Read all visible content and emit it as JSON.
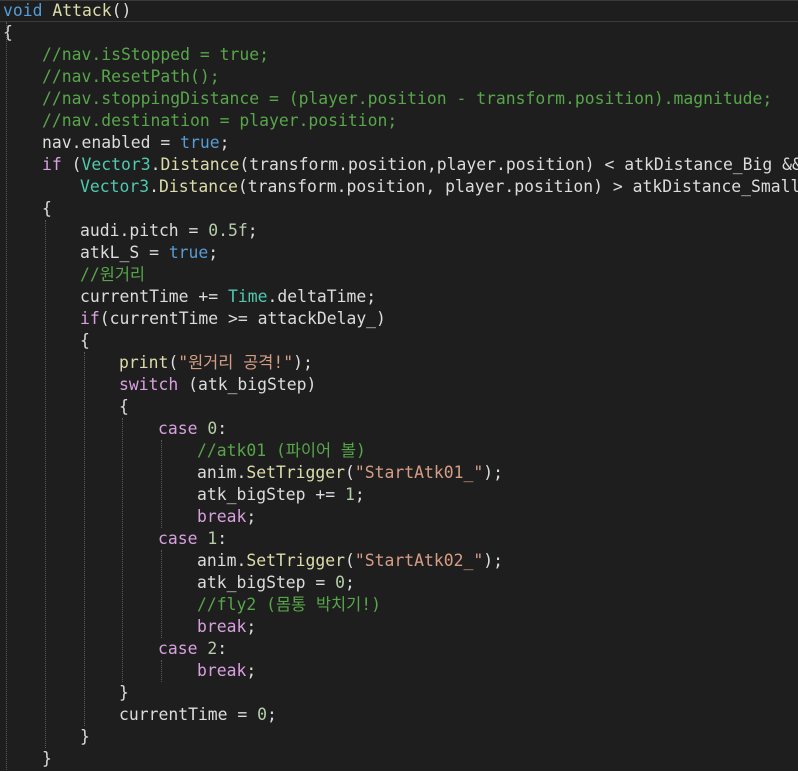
{
  "editor": {
    "language": "C#",
    "theme_background": "#1e1e1e",
    "colors": {
      "keyword": "#569cd6",
      "control": "#d8a0df",
      "comment": "#57a64a",
      "string": "#d69d85",
      "number": "#b5cea8",
      "type": "#4ec9b0",
      "method": "#dcdcaa",
      "plain": "#dcdcdc"
    },
    "lines": [
      [
        [
          "kw",
          "void"
        ],
        [
          "id",
          " "
        ],
        [
          "fn",
          "Attack"
        ],
        [
          "id",
          "()"
        ]
      ],
      [
        [
          "id",
          "{"
        ]
      ],
      [
        [
          "cm",
          "//nav.isStopped = true;"
        ]
      ],
      [
        [
          "cm",
          "//nav.ResetPath();"
        ]
      ],
      [
        [
          "cm",
          "//nav.stoppingDistance = (player.position - transform.position).magnitude;"
        ]
      ],
      [
        [
          "cm",
          "//nav.destination = player.position;"
        ]
      ],
      [
        [
          "id",
          "nav.enabled = "
        ],
        [
          "kw",
          "true"
        ],
        [
          "id",
          ";"
        ]
      ],
      [
        [
          "ctrl",
          "if"
        ],
        [
          "id",
          " ("
        ],
        [
          "type",
          "Vector3"
        ],
        [
          "id",
          "."
        ],
        [
          "fn",
          "Distance"
        ],
        [
          "id",
          "(transform.position,player.position) < atkDistance_Big &&"
        ]
      ],
      [
        [
          "type",
          "Vector3"
        ],
        [
          "id",
          "."
        ],
        [
          "fn",
          "Distance"
        ],
        [
          "id",
          "(transform.position, player.position) > atkDistance_Small)"
        ]
      ],
      [
        [
          "id",
          "{"
        ]
      ],
      [
        [
          "id",
          "audi.pitch = "
        ],
        [
          "num",
          "0.5f"
        ],
        [
          "id",
          ";"
        ]
      ],
      [
        [
          "id",
          "atkL_S = "
        ],
        [
          "kw",
          "true"
        ],
        [
          "id",
          ";"
        ]
      ],
      [
        [
          "cm",
          "//원거리"
        ]
      ],
      [
        [
          "id",
          "currentTime += "
        ],
        [
          "type",
          "Time"
        ],
        [
          "id",
          ".deltaTime;"
        ]
      ],
      [
        [
          "ctrl",
          "if"
        ],
        [
          "id",
          "(currentTime >= attackDelay_)"
        ]
      ],
      [
        [
          "id",
          "{"
        ]
      ],
      [
        [
          "fn",
          "print"
        ],
        [
          "id",
          "("
        ],
        [
          "str",
          "\"원거리 공격!\""
        ],
        [
          "id",
          ");"
        ]
      ],
      [
        [
          "ctrl",
          "switch"
        ],
        [
          "id",
          " (atk_bigStep)"
        ]
      ],
      [
        [
          "id",
          "{"
        ]
      ],
      [
        [
          "ctrl",
          "case"
        ],
        [
          "id",
          " "
        ],
        [
          "num",
          "0"
        ],
        [
          "id",
          ":"
        ]
      ],
      [
        [
          "cm",
          "//atk01 (파이어 볼)"
        ]
      ],
      [
        [
          "id",
          "anim."
        ],
        [
          "fn",
          "SetTrigger"
        ],
        [
          "id",
          "("
        ],
        [
          "str",
          "\"StartAtk01_\""
        ],
        [
          "id",
          ");"
        ]
      ],
      [
        [
          "id",
          "atk_bigStep += "
        ],
        [
          "num",
          "1"
        ],
        [
          "id",
          ";"
        ]
      ],
      [
        [
          "ctrl",
          "break"
        ],
        [
          "id",
          ";"
        ]
      ],
      [
        [
          "ctrl",
          "case"
        ],
        [
          "id",
          " "
        ],
        [
          "num",
          "1"
        ],
        [
          "id",
          ":"
        ]
      ],
      [
        [
          "id",
          "anim."
        ],
        [
          "fn",
          "SetTrigger"
        ],
        [
          "id",
          "("
        ],
        [
          "str",
          "\"StartAtk02_\""
        ],
        [
          "id",
          ");"
        ]
      ],
      [
        [
          "id",
          "atk_bigStep = "
        ],
        [
          "num",
          "0"
        ],
        [
          "id",
          ";"
        ]
      ],
      [
        [
          "cm",
          "//fly2 (몸통 박치기!)"
        ]
      ],
      [
        [
          "ctrl",
          "break"
        ],
        [
          "id",
          ";"
        ]
      ],
      [
        [
          "ctrl",
          "case"
        ],
        [
          "id",
          " "
        ],
        [
          "num",
          "2"
        ],
        [
          "id",
          ":"
        ]
      ],
      [
        [
          "ctrl",
          "break"
        ],
        [
          "id",
          ";"
        ]
      ],
      [
        [
          "id",
          "}"
        ]
      ],
      [
        [
          "id",
          "currentTime = "
        ],
        [
          "num",
          "0"
        ],
        [
          "id",
          ";"
        ]
      ],
      [
        [
          "id",
          "}"
        ]
      ],
      [
        [
          "id",
          "}"
        ]
      ]
    ]
  }
}
